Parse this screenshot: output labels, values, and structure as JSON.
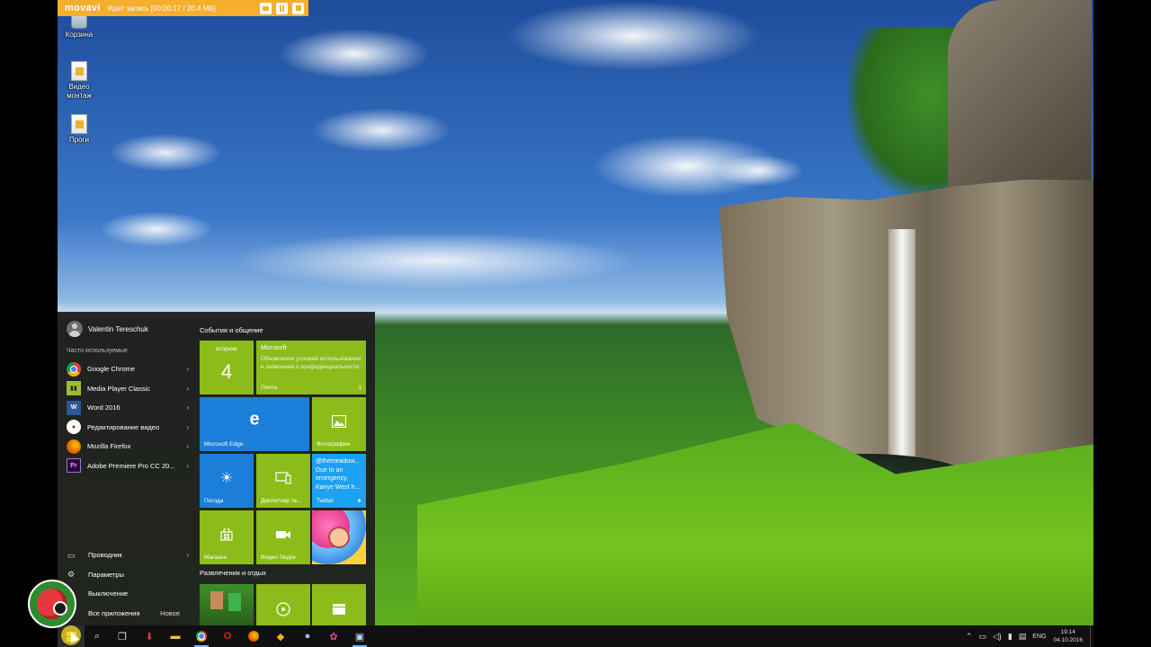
{
  "recorder": {
    "logo": "movavi",
    "status": "Идет запись  [00:00:17 / 20.4 МБ]",
    "buttons": [
      "camera-icon",
      "pause-icon",
      "stop-icon"
    ]
  },
  "desktop_icons": [
    {
      "label": "Корзина",
      "icon": "recycle-bin-icon"
    },
    {
      "label": "Видео монтаж",
      "icon": "file-icon"
    },
    {
      "label": "Проги",
      "icon": "file-icon"
    }
  ],
  "start_menu": {
    "user": "Valentin Tereschuk",
    "frequent_title": "Часто используемые",
    "apps": [
      {
        "label": "Google Chrome",
        "icon": "chrome-icon",
        "has_submenu": true
      },
      {
        "label": "Media Player Classic",
        "icon": "mpc-icon",
        "has_submenu": true
      },
      {
        "label": "Word 2016",
        "icon": "word-icon",
        "has_submenu": true
      },
      {
        "label": "Редактирование видео",
        "icon": "video-editor-icon",
        "has_submenu": true
      },
      {
        "label": "Mozilla Firefox",
        "icon": "firefox-icon",
        "has_submenu": true
      },
      {
        "label": "Adobe Premiere Pro CC 20...",
        "icon": "premiere-icon",
        "has_submenu": true
      }
    ],
    "bottom": [
      {
        "label": "Проводник",
        "icon": "explorer-icon",
        "has_submenu": true
      },
      {
        "label": "Параметры",
        "icon": "settings-gear-icon"
      },
      {
        "label": "Выключение",
        "icon": "power-icon"
      },
      {
        "label": "Все приложения",
        "icon": "all-apps-icon",
        "badge": "Новое"
      }
    ],
    "group1_title": "События и общение",
    "group2_title": "Развлечения и отдых",
    "tiles": {
      "calendar_day": "вторник",
      "calendar_num": "4",
      "mail_sender": "Microsoft",
      "mail_text": "Обновление условий использования и заявления о конфиденциальности",
      "mail_label": "Почта",
      "mail_count": "1",
      "edge_label": "Microsoft Edge",
      "photos_label": "Фотографии",
      "weather_label": "Погода",
      "phone_label": "Диспетчер те...",
      "twitter_text": "@themeadow... Due to an emergency, Kanye West h...",
      "twitter_label": "Twitter",
      "store_label": "Магазин",
      "skype_label": "Видео Skype"
    }
  },
  "taskbar": {
    "icons": [
      "start-icon",
      "search-icon",
      "task-view-icon",
      "download-icon",
      "folder-icon",
      "chrome-icon",
      "opera-icon",
      "firefox-icon",
      "movavi-icon",
      "app-icon",
      "photos-icon",
      "media-icon"
    ],
    "language": "ENG",
    "time": "19:14",
    "date": "04.10.2016"
  },
  "colors": {
    "accent_green": "#8cbc1a",
    "accent_blue": "#1b7ed8",
    "recorder_orange": "#f6ae2d",
    "start_bg": "#1f1f1f"
  }
}
